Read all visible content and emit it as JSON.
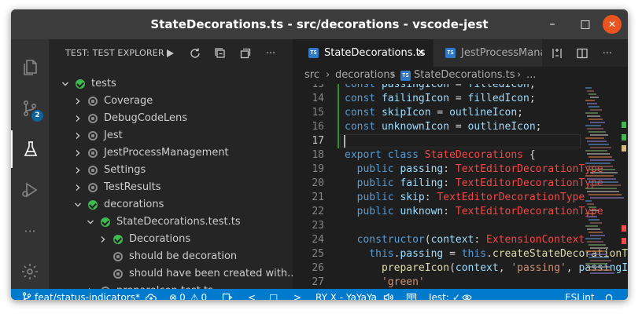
{
  "window": {
    "title": "StateDecorations.ts - src/decorations - vscode-jest",
    "controls": {
      "minimize": "–",
      "maximize": "□",
      "close": "✕"
    }
  },
  "activity_bar": {
    "items": [
      {
        "name": "explorer",
        "icon": "files-icon"
      },
      {
        "name": "source-control",
        "icon": "source-control-icon",
        "badge": "2"
      },
      {
        "name": "testing",
        "icon": "flask-icon",
        "active": true
      },
      {
        "name": "run-debug",
        "icon": "run-debug-icon"
      },
      {
        "name": "more",
        "icon": "ellipsis-icon",
        "label": "···"
      },
      {
        "name": "manage",
        "icon": "gear-icon"
      }
    ]
  },
  "sidebar": {
    "title": "TEST: TEST EXPLORER",
    "actions": [
      {
        "name": "run-all-tests",
        "icon": "play-icon"
      },
      {
        "name": "refresh-tests",
        "icon": "refresh-icon"
      },
      {
        "name": "collapse-all",
        "icon": "collapse-icon"
      },
      {
        "name": "show-output",
        "icon": "output-icon"
      },
      {
        "name": "more-actions",
        "icon": "ellipsis-icon",
        "label": "···"
      }
    ],
    "tree": [
      {
        "label": "tests",
        "depth": 0,
        "expanded": true,
        "status": "passed"
      },
      {
        "label": "Coverage",
        "depth": 1,
        "expanded": false,
        "status": "unset"
      },
      {
        "label": "DebugCodeLens",
        "depth": 1,
        "expanded": false,
        "status": "unset"
      },
      {
        "label": "Jest",
        "depth": 1,
        "expanded": false,
        "status": "unset"
      },
      {
        "label": "JestProcessManagement",
        "depth": 1,
        "expanded": false,
        "status": "unset"
      },
      {
        "label": "Settings",
        "depth": 1,
        "expanded": false,
        "status": "unset"
      },
      {
        "label": "TestResults",
        "depth": 1,
        "expanded": false,
        "status": "unset"
      },
      {
        "label": "decorations",
        "depth": 1,
        "expanded": true,
        "status": "passed"
      },
      {
        "label": "StateDecorations.test.ts",
        "depth": 2,
        "expanded": true,
        "status": "passed"
      },
      {
        "label": "Decorations",
        "depth": 3,
        "expanded": false,
        "status": "passed"
      },
      {
        "label": "should be decoration",
        "depth": 3,
        "leaf": true,
        "status": "unset"
      },
      {
        "label": "should have been created with...",
        "depth": 3,
        "leaf": true,
        "status": "unset"
      },
      {
        "label": "prepareIcon.test.ts",
        "depth": 2,
        "expanded": false,
        "status": "unset"
      }
    ]
  },
  "editor": {
    "tabs": [
      {
        "label": "StateDecorations.ts",
        "active": true,
        "icon_text": "TS",
        "close": "✕"
      },
      {
        "label": "JestProcessManag",
        "active": false,
        "icon_text": "TS"
      }
    ],
    "tab_actions": [
      {
        "name": "open-changes",
        "icon": "diff-icon"
      },
      {
        "name": "split-editor",
        "icon": "split-icon"
      },
      {
        "name": "more-actions",
        "icon": "ellipsis-icon",
        "label": "···"
      }
    ],
    "breadcrumbs": [
      "src",
      "decorations",
      "StateDecorations.ts",
      "..."
    ],
    "breadcrumb_icon_text": "TS",
    "current_line": 17,
    "lines": [
      {
        "n": "13",
        "tokens": [
          [
            "c-kw",
            "const "
          ],
          [
            "c-var",
            "passingIcon"
          ],
          [
            "c-punc",
            " = "
          ],
          [
            "c-var",
            "filledIcon"
          ],
          [
            "c-punc",
            ";"
          ]
        ]
      },
      {
        "n": "14",
        "tokens": [
          [
            "c-kw",
            "const "
          ],
          [
            "c-var",
            "failingIcon"
          ],
          [
            "c-punc",
            " = "
          ],
          [
            "c-var",
            "filledIcon"
          ],
          [
            "c-punc",
            ";"
          ]
        ]
      },
      {
        "n": "15",
        "tokens": [
          [
            "c-kw",
            "const "
          ],
          [
            "c-var",
            "skipIcon"
          ],
          [
            "c-punc",
            " = "
          ],
          [
            "c-var",
            "outlineIcon"
          ],
          [
            "c-punc",
            ";"
          ]
        ]
      },
      {
        "n": "16",
        "tokens": [
          [
            "c-kw",
            "const "
          ],
          [
            "c-var",
            "unknownIcon"
          ],
          [
            "c-punc",
            " = "
          ],
          [
            "c-var",
            "outlineIcon"
          ],
          [
            "c-punc",
            ";"
          ]
        ]
      },
      {
        "n": "17",
        "tokens": []
      },
      {
        "n": "18",
        "tokens": [
          [
            "c-kw",
            "export "
          ],
          [
            "c-kw",
            "class "
          ],
          [
            "c-type",
            "StateDecorations"
          ],
          [
            "c-punc",
            " {"
          ]
        ]
      },
      {
        "n": "19",
        "tokens": [
          [
            "c-kw",
            "  public "
          ],
          [
            "c-var",
            "passing"
          ],
          [
            "c-punc",
            ": "
          ],
          [
            "c-type",
            "TextEditorDecorationType"
          ]
        ]
      },
      {
        "n": "20",
        "tokens": [
          [
            "c-kw",
            "  public "
          ],
          [
            "c-var",
            "failing"
          ],
          [
            "c-punc",
            ": "
          ],
          [
            "c-type",
            "TextEditorDecorationType"
          ]
        ]
      },
      {
        "n": "21",
        "tokens": [
          [
            "c-kw",
            "  public "
          ],
          [
            "c-var",
            "skip"
          ],
          [
            "c-punc",
            ": "
          ],
          [
            "c-type",
            "TextEditorDecorationType"
          ]
        ]
      },
      {
        "n": "22",
        "tokens": [
          [
            "c-kw",
            "  public "
          ],
          [
            "c-var",
            "unknown"
          ],
          [
            "c-punc",
            ": "
          ],
          [
            "c-type",
            "TextEditorDecorationType"
          ]
        ]
      },
      {
        "n": "23",
        "tokens": []
      },
      {
        "n": "24",
        "tokens": [
          [
            "c-kw",
            "  constructor"
          ],
          [
            "c-punc",
            "("
          ],
          [
            "c-var",
            "context"
          ],
          [
            "c-punc",
            ": "
          ],
          [
            "c-type",
            "ExtensionContext"
          ]
        ]
      },
      {
        "n": "25",
        "tokens": [
          [
            "c-kw",
            "    this"
          ],
          [
            "c-punc",
            "."
          ],
          [
            "c-var",
            "passing"
          ],
          [
            "c-punc",
            " = "
          ],
          [
            "c-kw",
            "this"
          ],
          [
            "c-punc",
            "."
          ],
          [
            "c-fn",
            "createStateDecorationType"
          ]
        ]
      },
      {
        "n": "26",
        "tokens": [
          [
            "c-fn",
            "      prepareIcon"
          ],
          [
            "c-punc",
            "("
          ],
          [
            "c-var",
            "context"
          ],
          [
            "c-punc",
            ", "
          ],
          [
            "c-str",
            "'passing'"
          ],
          [
            "c-punc",
            ", "
          ],
          [
            "c-var",
            "passingIcon"
          ]
        ]
      },
      {
        "n": "27",
        "tokens": [
          [
            "c-str",
            "      'green'"
          ]
        ]
      }
    ]
  },
  "statusbar": {
    "branch": "feat/status-indicators*",
    "errors": "0",
    "warnings": "0",
    "nav_prev": "<",
    "nav_stop": "□",
    "nav_next": ">",
    "player": "RY X - YaYaYa",
    "jest": "Jest:",
    "eslint": "ESLint"
  },
  "colors": {
    "accent": "#007acc",
    "pass": "#3fb950",
    "titlebar": "#3c3c3c"
  }
}
